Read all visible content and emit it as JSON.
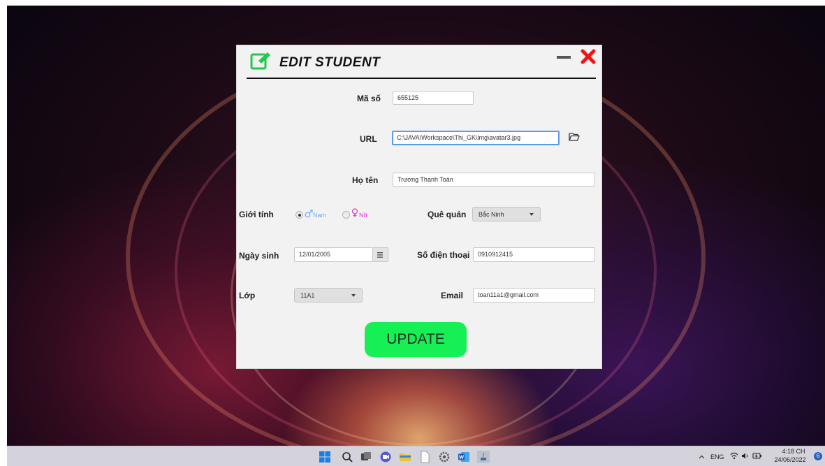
{
  "window": {
    "title": "EDIT STUDENT",
    "accent_color": "#16f054"
  },
  "form": {
    "id_label": "Mã số",
    "id_value": "655125",
    "url_label": "URL",
    "url_value": "C:\\JAVA\\Workspace\\Thi_GK\\img\\avatar3.jpg",
    "name_label": "Họ tên",
    "name_value": "Trương Thanh Toàn",
    "gender_label": "Giới tính",
    "gender_options": [
      {
        "label": "Nam",
        "selected": true,
        "color": "#6aa9ff"
      },
      {
        "label": "Nữ",
        "selected": false,
        "color": "#e23ad2"
      }
    ],
    "hometown_label": "Quê quán",
    "hometown_value": "Bắc Ninh",
    "dob_label": "Ngày sinh",
    "dob_value": "12/01/2005",
    "phone_label": "Số điện thoại",
    "phone_value": "0910912415",
    "class_label": "Lớp",
    "class_value": "11A1",
    "email_label": "Email",
    "email_value": "toan11a1@gmail.com",
    "submit_label": "UPDATE"
  },
  "taskbar": {
    "icons": [
      "windows-start-icon",
      "search-icon",
      "task-view-icon",
      "chat-icon",
      "file-explorer-icon",
      "notepad-icon",
      "settings-icon",
      "word-icon",
      "java-app-icon"
    ],
    "tray": {
      "language": "ENG",
      "time": "4:18 CH",
      "date": "24/06/2022",
      "notification_count": "6"
    }
  }
}
